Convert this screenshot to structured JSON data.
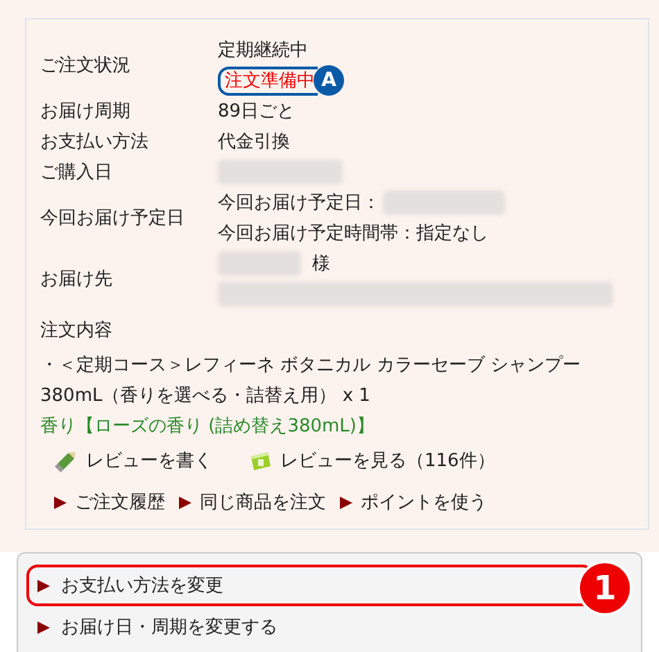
{
  "order": {
    "rows": [
      {
        "label": "ご注文状況",
        "lines": [
          {
            "kind": "text",
            "text": "定期継続中"
          },
          {
            "kind": "status",
            "text": "注文準備中",
            "badge": "A"
          }
        ]
      },
      {
        "label": "お届け周期",
        "lines": [
          {
            "kind": "text",
            "text": "89日ごと"
          }
        ]
      },
      {
        "label": "お支払い方法",
        "lines": [
          {
            "kind": "text",
            "text": "代金引換"
          }
        ]
      },
      {
        "label": "ご購入日",
        "lines": [
          {
            "kind": "redacted"
          }
        ]
      },
      {
        "label": "今回お届け予定日",
        "lines": [
          {
            "kind": "prefix_redacted",
            "text": "今回お届け予定日："
          },
          {
            "kind": "text",
            "text": "今回お届け予定時間帯：指定なし"
          }
        ]
      },
      {
        "label": "お届け先",
        "lines": [
          {
            "kind": "redacted_suffix",
            "text": "様"
          },
          {
            "kind": "redacted_long"
          }
        ]
      }
    ],
    "contents_label": "注文内容",
    "item": "・＜定期コース＞レフィーネ ボタニカル カラーセーブ シャンプー380mL（香りを選べる・詰替え用） x 1",
    "variant": "香り【ローズの香り (詰め替え380mL)】",
    "review_links": [
      {
        "kind": "write",
        "text": "レビューを書く"
      },
      {
        "kind": "read",
        "text": "レビューを見る（116件）"
      }
    ],
    "links": [
      "ご注文履歴",
      "同じ商品を注文",
      "ポイントを使う"
    ]
  },
  "menu": {
    "items": [
      {
        "text": "お支払い方法を変更",
        "highlighted": true,
        "marker": "1"
      },
      {
        "text": "お届け日・周期を変更する",
        "highlighted": false
      }
    ]
  }
}
